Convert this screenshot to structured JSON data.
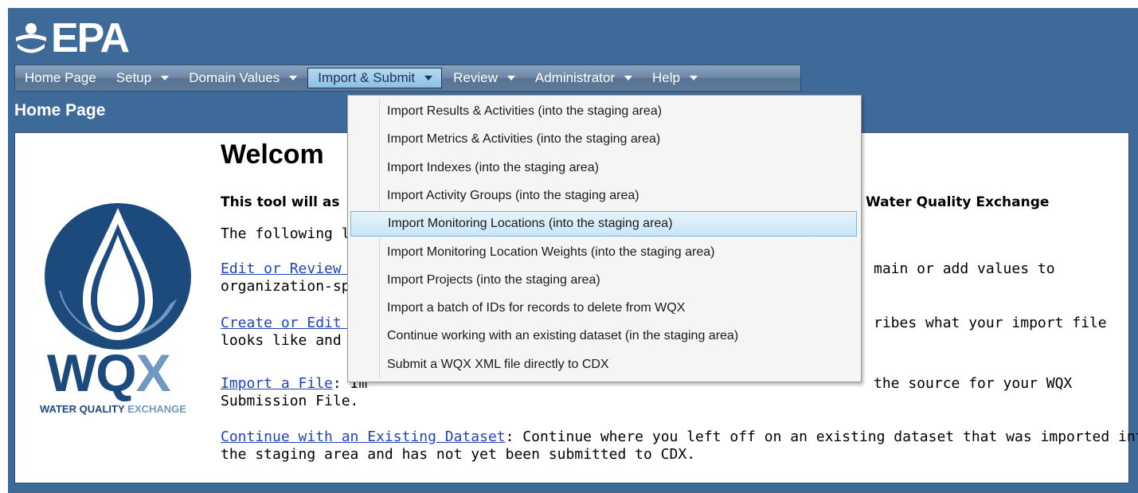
{
  "header": {
    "logo_text": "EPA"
  },
  "menu": [
    {
      "label": "Home Page",
      "has_arrow": false
    },
    {
      "label": "Setup",
      "has_arrow": true
    },
    {
      "label": "Domain Values",
      "has_arrow": true
    },
    {
      "label": "Import & Submit",
      "has_arrow": true,
      "active": true
    },
    {
      "label": "Review",
      "has_arrow": true
    },
    {
      "label": "Administrator",
      "has_arrow": true
    },
    {
      "label": "Help",
      "has_arrow": true
    }
  ],
  "page_title": "Home Page",
  "wqx_logo": {
    "letters": "WQX",
    "tagline_a": "WATER QUALITY",
    "tagline_b": "EXCHANGE"
  },
  "main": {
    "welcome": "Welcom",
    "intro_left": "This tool will as",
    "intro_right": "Water Quality Exchange",
    "following": "The following link",
    "link1": "Edit or Review Do",
    "link1_right": "main or add values to",
    "link1_line2": "organization-sp",
    "link2": "Create or Edit an",
    "link2_right": "ribes what your import file",
    "link2_line2": "looks like and h",
    "link3": "Import a File",
    "link3_after": ":  Im",
    "link3_right": "the source for your WQX",
    "link3_line2": "Submission File.",
    "link4": "Continue with an Existing Dataset",
    "link4_after": ":  Continue where you left off on an existing dataset that was imported into",
    "link4_line2": "the staging area and has not yet been submitted to CDX."
  },
  "dropdown": {
    "highlighted_index": 4,
    "items": [
      "Import Results & Activities (into the staging area)",
      "Import Metrics & Activities (into the staging area)",
      "Import Indexes (into the staging area)",
      "Import Activity Groups (into the staging area)",
      "Import Monitoring Locations (into the staging area)",
      "Import Monitoring Location Weights (into the staging area)",
      "Import Projects (into the staging area)",
      "Import a batch of IDs for records to delete from WQX",
      "Continue working with an existing dataset (in the staging area)",
      "Submit a WQX XML file directly to CDX"
    ]
  },
  "colors": {
    "header_blue": "#3e6a9a",
    "menu_active": "#8cc0e4",
    "link": "#2244bb",
    "wqx_dark": "#1c4a7d",
    "wqx_light": "#6f98c3"
  },
  "icons": [
    "epa-logo-icon",
    "dropdown-arrow-icon",
    "wqx-drop-logo-icon"
  ]
}
